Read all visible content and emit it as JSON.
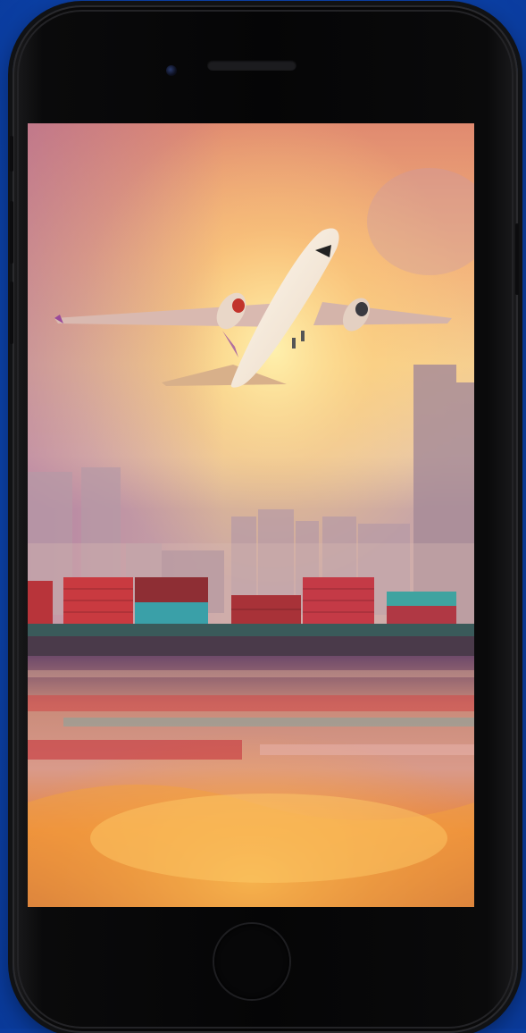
{
  "scene": {
    "subject": "airplane-taking-off-over-container-port",
    "colors": {
      "background_blue": "#0d47b5",
      "phone_body": "#050506",
      "sky_top": "#d98a6e",
      "sky_glow": "#ffe08a",
      "water_orange": "#f08a2a"
    }
  }
}
